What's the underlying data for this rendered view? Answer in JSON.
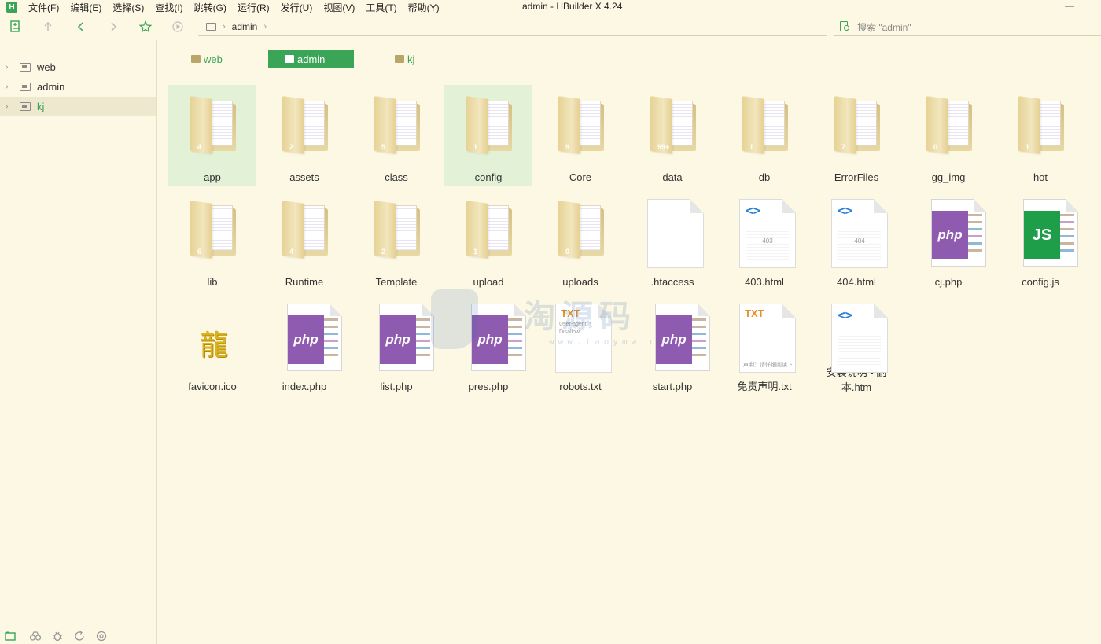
{
  "app": {
    "logo_letter": "H",
    "window_title": "admin - HBuilder X 4.24",
    "minimize_glyph": "—"
  },
  "menu": [
    "文件(F)",
    "编辑(E)",
    "选择(S)",
    "查找(I)",
    "跳转(G)",
    "运行(R)",
    "发行(U)",
    "视图(V)",
    "工具(T)",
    "帮助(Y)"
  ],
  "toolbar": {
    "icons": [
      "new-file-icon",
      "up-arrow-icon",
      "back-icon",
      "forward-icon",
      "star-icon",
      "play-icon"
    ],
    "breadcrumb": [
      "admin"
    ],
    "search_placeholder": "搜索 \"admin\""
  },
  "sidebar": {
    "items": [
      {
        "label": "web",
        "selected": false
      },
      {
        "label": "admin",
        "selected": false
      },
      {
        "label": "kj",
        "selected": true
      }
    ],
    "footer_icons": [
      "project-manager-icon",
      "binoculars-icon",
      "bug-icon",
      "sync-icon",
      "plugin-icon"
    ]
  },
  "tabs": [
    {
      "label": "web",
      "active": false
    },
    {
      "label": "admin",
      "active": true
    },
    {
      "label": "kj",
      "active": false
    }
  ],
  "files": [
    {
      "name": "app",
      "kind": "folder",
      "count": "4",
      "highlight": true
    },
    {
      "name": "assets",
      "kind": "folder",
      "count": "2"
    },
    {
      "name": "class",
      "kind": "folder",
      "count": "5"
    },
    {
      "name": "config",
      "kind": "folder",
      "count": "1",
      "highlight": true
    },
    {
      "name": "Core",
      "kind": "folder",
      "count": "9"
    },
    {
      "name": "data",
      "kind": "folder",
      "count": "99+"
    },
    {
      "name": "db",
      "kind": "folder",
      "count": "1"
    },
    {
      "name": "ErrorFiles",
      "kind": "folder",
      "count": "7"
    },
    {
      "name": "gg_img",
      "kind": "folder",
      "count": "0"
    },
    {
      "name": "hot",
      "kind": "folder",
      "count": "1"
    },
    {
      "name": "lib",
      "kind": "folder",
      "count": "6"
    },
    {
      "name": "Runtime",
      "kind": "folder",
      "count": "4"
    },
    {
      "name": "Template",
      "kind": "folder",
      "count": "2"
    },
    {
      "name": "upload",
      "kind": "folder",
      "count": "1"
    },
    {
      "name": "uploads",
      "kind": "folder",
      "count": "0"
    },
    {
      "name": ".htaccess",
      "kind": "blank"
    },
    {
      "name": "403.html",
      "kind": "html",
      "preview": "403"
    },
    {
      "name": "404.html",
      "kind": "html",
      "preview": "404"
    },
    {
      "name": "cj.php",
      "kind": "php"
    },
    {
      "name": "config.js",
      "kind": "js"
    },
    {
      "name": "favicon.ico",
      "kind": "ico",
      "glyph": "龍"
    },
    {
      "name": "index.php",
      "kind": "php"
    },
    {
      "name": "list.php",
      "kind": "php"
    },
    {
      "name": "pres.php",
      "kind": "php"
    },
    {
      "name": "robots.txt",
      "kind": "txt",
      "preview1": "User-agent: *",
      "preview2": "Disallow:"
    },
    {
      "name": "start.php",
      "kind": "php"
    },
    {
      "name": "免责声明.txt",
      "kind": "txt",
      "preview1": "",
      "preview2": "声明：请仔细阅读下"
    },
    {
      "name": "安装说明 - 副本.htm",
      "kind": "htm"
    }
  ],
  "icon_text": {
    "php": "php",
    "js": "JS",
    "txt": "TXT",
    "code": "<>"
  },
  "watermark": {
    "text": "淘源码",
    "url": "www.taoymw.com"
  },
  "colors": {
    "background": "#fdf8e4",
    "accent": "#3aa457",
    "php": "#8e5bb0",
    "js": "#1f9e4a",
    "html": "#2b7fd8",
    "txt": "#e8902a"
  }
}
